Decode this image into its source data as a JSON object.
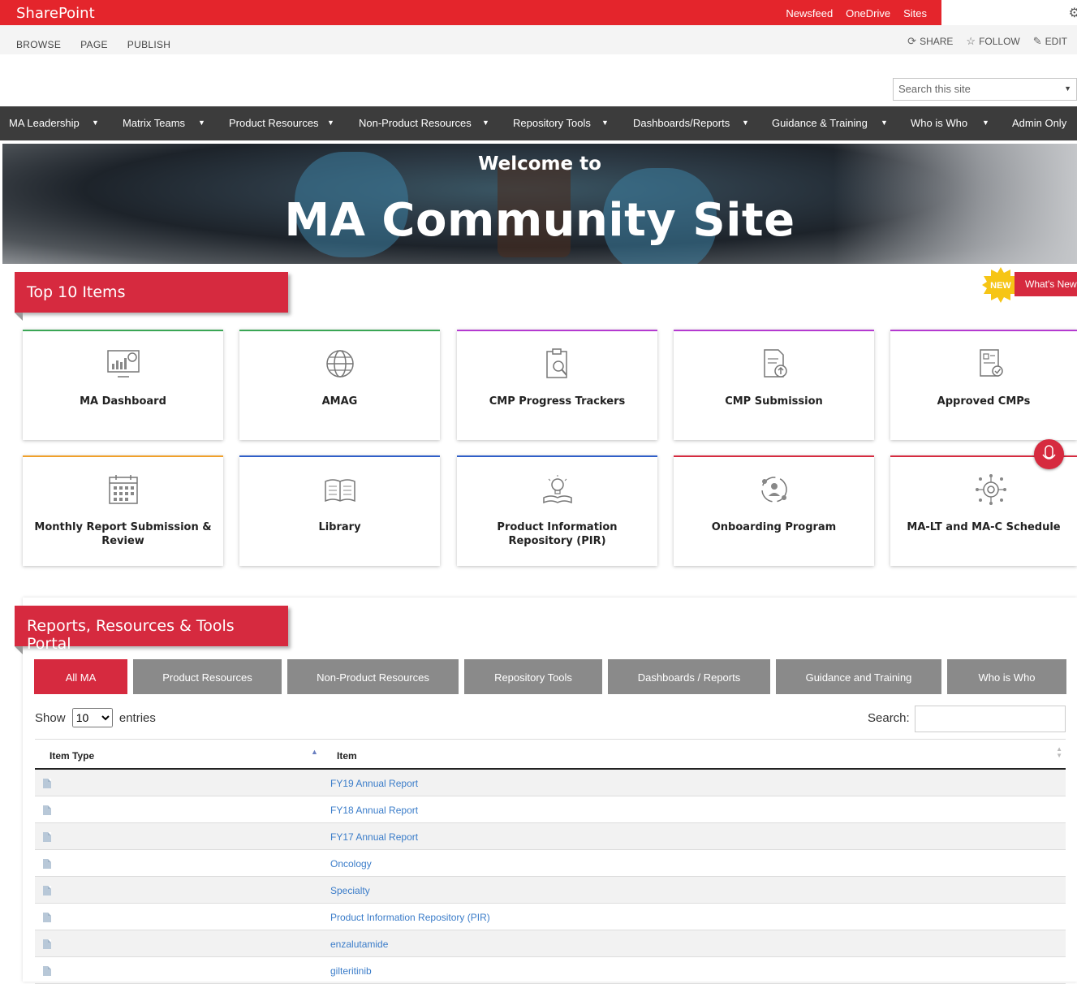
{
  "suite": {
    "brand": "SharePoint",
    "links": [
      "Newsfeed",
      "OneDrive",
      "Sites"
    ]
  },
  "ribbon": {
    "tabs": [
      "BROWSE",
      "PAGE",
      "PUBLISH"
    ],
    "actions": {
      "share": "SHARE",
      "follow": "FOLLOW",
      "edit": "EDIT"
    }
  },
  "search": {
    "placeholder": "Search this site"
  },
  "nav": [
    "MA Leadership",
    "Matrix Teams",
    "Product Resources",
    "Non-Product Resources",
    "Repository Tools",
    "Dashboards/Reports",
    "Guidance & Training",
    "Who is Who",
    "Admin Only"
  ],
  "hero": {
    "welcome": "Welcome to",
    "title": "MA Community Site"
  },
  "top10": {
    "heading": "Top 10 Items",
    "badge": "NEW",
    "whats_new": "What's New",
    "tiles": [
      {
        "label": "MA Dashboard",
        "icon": "dashboard-icon",
        "accent": "#3aa655"
      },
      {
        "label": "AMAG",
        "icon": "globe-icon",
        "accent": "#3aa655"
      },
      {
        "label": "CMP Progress Trackers",
        "icon": "clipboard-search-icon",
        "accent": "#b43ad0"
      },
      {
        "label": "CMP Submission",
        "icon": "document-upload-icon",
        "accent": "#b43ad0"
      },
      {
        "label": "Approved CMPs",
        "icon": "document-check-icon",
        "accent": "#b43ad0"
      },
      {
        "label": "Monthly Report Submission & Review",
        "icon": "calendar-icon",
        "accent": "#f0a02a"
      },
      {
        "label": "Library",
        "icon": "book-icon",
        "accent": "#2f5ec8"
      },
      {
        "label": "Product Information Repository (PIR)",
        "icon": "lightbulb-book-icon",
        "accent": "#2f5ec8"
      },
      {
        "label": "Onboarding Program",
        "icon": "people-cycle-icon",
        "accent": "#d62a3f"
      },
      {
        "label": "MA-LT and MA-C Schedule",
        "icon": "gear-network-icon",
        "accent": "#d62a3f"
      }
    ]
  },
  "portal": {
    "heading": "Reports, Resources & Tools Portal",
    "tabs": [
      "All MA",
      "Product Resources",
      "Non-Product Resources",
      "Repository Tools",
      "Dashboards / Reports",
      "Guidance and Training",
      "Who is Who"
    ],
    "show_label": "Show",
    "entries_label": "entries",
    "page_size": "10",
    "search_label": "Search:",
    "columns": [
      "Item Type",
      "Item"
    ],
    "rows": [
      "FY19 Annual Report",
      "FY18 Annual Report",
      "FY17 Annual Report",
      "Oncology",
      "Specialty",
      "Product Information Repository (PIR)",
      "enzalutamide",
      "gilteritinib"
    ]
  },
  "colors": {
    "brand_red": "#e4252c",
    "accent_red": "#d62a3f",
    "nav_bg": "#3c3c3c",
    "tab_gray": "#8a8a8a",
    "link_blue": "#3a7cc9"
  }
}
